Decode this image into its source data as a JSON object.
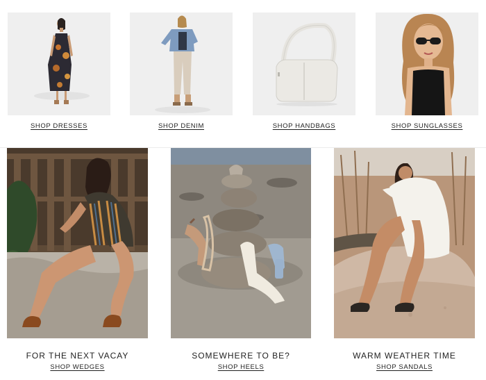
{
  "top_row": {
    "items": [
      {
        "link_label": "SHOP DRESSES"
      },
      {
        "link_label": "SHOP DENIM"
      },
      {
        "link_label": "SHOP HANDBAGS"
      },
      {
        "link_label": "SHOP SUNGLASSES"
      }
    ]
  },
  "bottom_row": {
    "items": [
      {
        "heading": "FOR THE NEXT VACAY",
        "link_label": "SHOP WEDGES"
      },
      {
        "heading": "SOMEWHERE TO BE?",
        "link_label": "SHOP HEELS"
      },
      {
        "heading": "WARM WEATHER TIME",
        "link_label": "SHOP SANDALS"
      }
    ]
  },
  "colors": {
    "product_bg": "#efefef",
    "text": "#1f1f1f"
  }
}
